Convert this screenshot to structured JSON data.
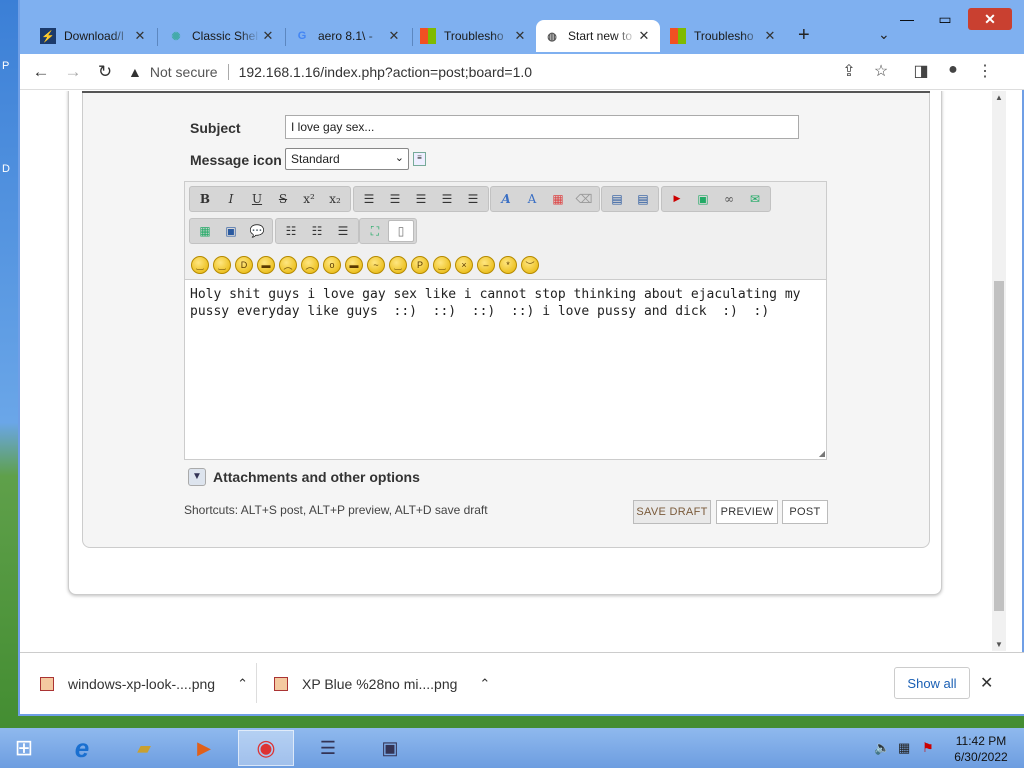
{
  "browser": {
    "tabs": [
      {
        "title": "Download/I",
        "icon": "download-site-icon",
        "active": false
      },
      {
        "title": "Classic Shel",
        "icon": "shell-icon",
        "active": false
      },
      {
        "title": "aero 8.1\\ - ",
        "icon": "google-icon",
        "active": false
      },
      {
        "title": "Troublesho",
        "icon": "microsoft-icon",
        "active": false
      },
      {
        "title": "Start new to",
        "icon": "globe-icon",
        "active": true
      },
      {
        "title": "Troublesho",
        "icon": "microsoft-icon",
        "active": false
      }
    ],
    "close_glyph": "✕",
    "new_tab_glyph": "+",
    "address": {
      "security": "Not secure",
      "url": "192.168.1.16/index.php?action=post;board=1.0"
    }
  },
  "form": {
    "subject_label": "Subject",
    "subject_value": "I love gay sex...",
    "icon_label": "Message icon",
    "icon_selected": "Standard",
    "message": "Holy shit guys i love gay sex like i cannot stop thinking about ejaculating my\npussy everyday like guys  ::)  ::)  ::)  ::) i love pussy and dick  :)  :)",
    "attachments_label": "Attachments and other options",
    "shortcuts": "Shortcuts: ALT+S post, ALT+P preview, ALT+D save draft",
    "buttons": {
      "save_draft": "SAVE DRAFT",
      "preview": "PREVIEW",
      "post": "POST"
    }
  },
  "editor_toolbar": {
    "bold": "B",
    "italic": "I",
    "underline": "U",
    "strike": "S",
    "sup": "x²",
    "sub": "x₂"
  },
  "downloads": {
    "items": [
      "windows-xp-look-....png",
      "XP Blue %28no mi....png"
    ],
    "show_all": "Show all"
  },
  "clock": {
    "time": "11:42 PM",
    "date": "6/30/2022"
  }
}
